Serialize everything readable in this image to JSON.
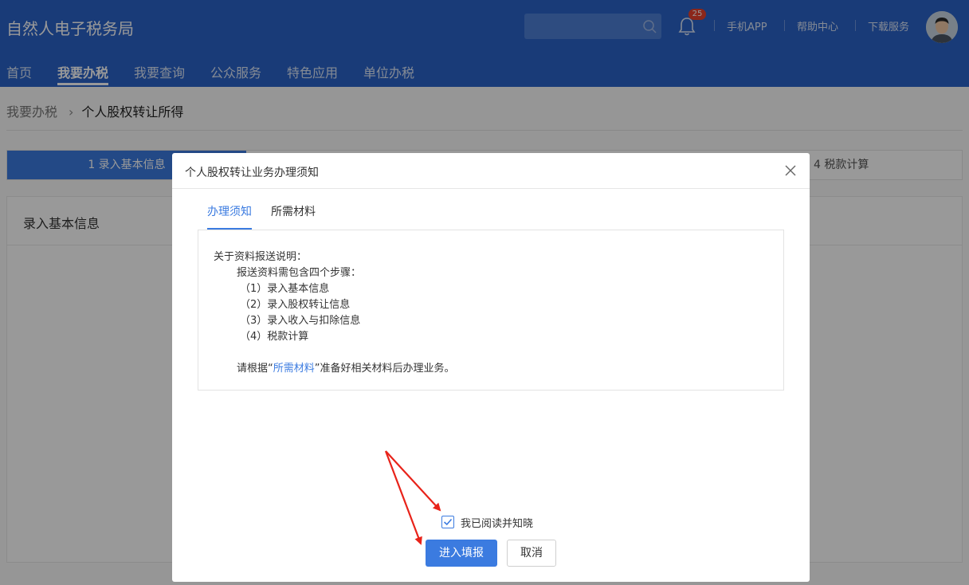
{
  "header": {
    "app_title": "自然人电子税务局",
    "search_placeholder": "",
    "notification_count": "25",
    "links": [
      "手机APP",
      "帮助中心",
      "下载服务"
    ]
  },
  "nav": {
    "items": [
      "首页",
      "我要办税",
      "我要查询",
      "公众服务",
      "特色应用",
      "单位办税"
    ],
    "active": "我要办税"
  },
  "breadcrumb": {
    "parent": "我要办税",
    "separator": "›",
    "current": "个人股权转让所得"
  },
  "steps": {
    "step1": "1  录入基本信息",
    "step4": "4  税款计算"
  },
  "panel": {
    "title": "录入基本信息"
  },
  "modal": {
    "title": "个人股权转让业务办理须知",
    "tabs": [
      "办理须知",
      "所需材料"
    ],
    "active_tab": "办理须知",
    "notice": {
      "line1": "关于资料报送说明：",
      "line2": "报送资料需包含四个步骤：",
      "items": [
        "（1）录入基本信息",
        "（2）录入股权转让信息",
        "（3）录入收入与扣除信息",
        "（4）税款计算"
      ],
      "footer_prefix": "请根据“",
      "footer_link": "所需材料",
      "footer_suffix": "”准备好相关材料后办理业务。"
    },
    "checkbox_label": "我已阅读并知晓",
    "checkbox_checked": true,
    "primary_button": "进入填报",
    "cancel_button": "取消"
  },
  "colors": {
    "header_bg": "#2a63c9",
    "accent": "#3b7be0",
    "badge": "#e8412c",
    "annotation_arrow": "#e8231a"
  },
  "icons": [
    "search-icon",
    "bell-icon",
    "close-icon",
    "check-icon",
    "user-avatar"
  ]
}
